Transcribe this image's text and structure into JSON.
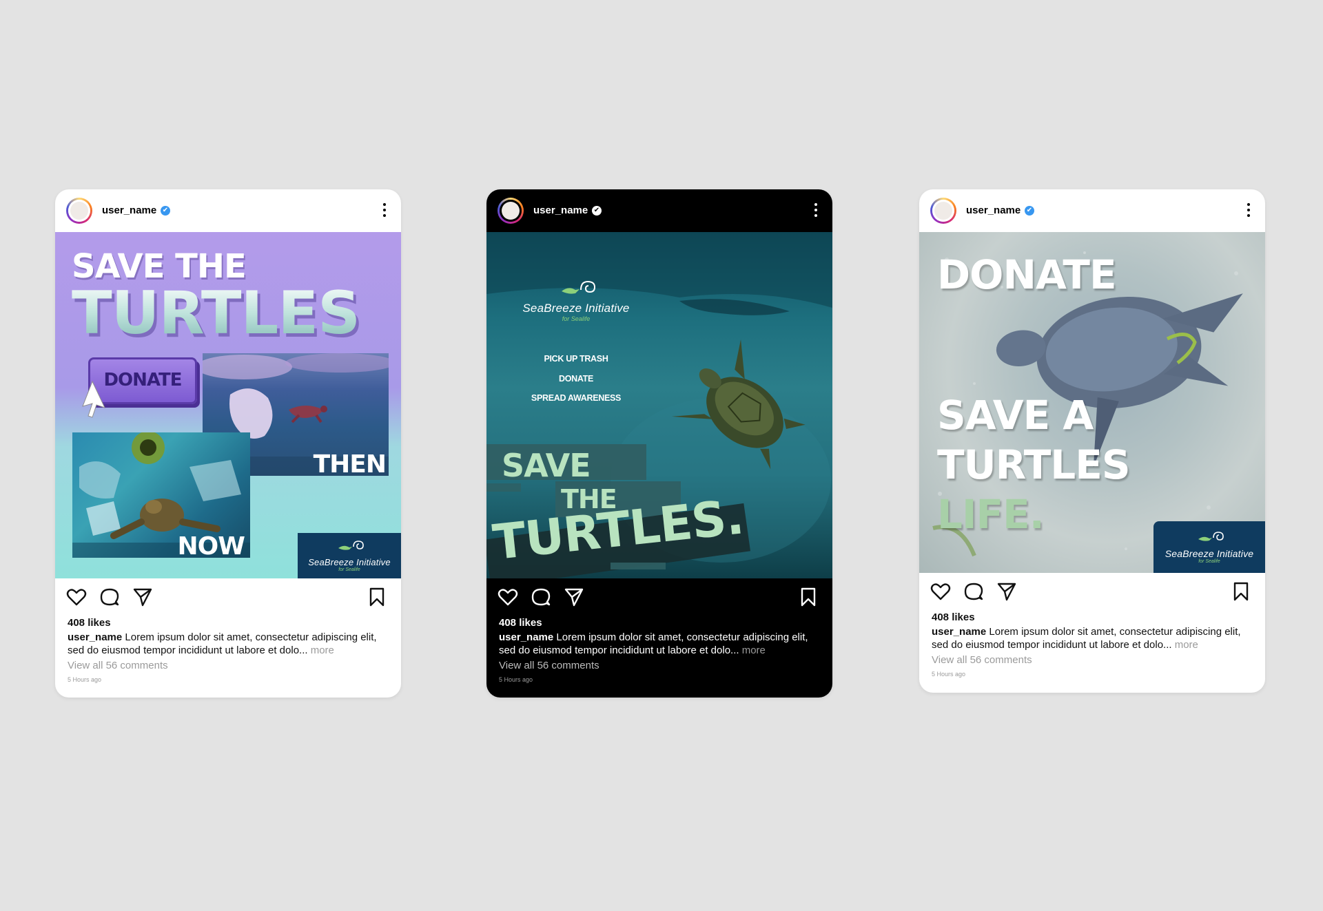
{
  "cards": [
    {
      "theme": "light",
      "header": {
        "username": "user_name",
        "verified_glyph": "✔"
      },
      "post": {
        "title_line1": "SAVE THE",
        "title_line2": "TURTLES",
        "donate_button": "DONATE",
        "label_then": "THEN",
        "label_now": "NOW",
        "logo_name": "SeaBreeze Initiative",
        "logo_sub": "for Sealife"
      },
      "footer": {
        "likes": "408 likes",
        "caption_user": "user_name",
        "caption_text": " Lorem ipsum dolor sit amet, consectetur adipiscing elit, sed do eiusmod tempor incididunt ut labore et dolo...",
        "caption_more": " more",
        "comments": "View all 56 comments",
        "time": "5 Hours ago"
      }
    },
    {
      "theme": "dark",
      "header": {
        "username": "user_name",
        "verified_glyph": "✔"
      },
      "post": {
        "logo_name": "SeaBreeze Initiative",
        "logo_sub": "for Sealife",
        "menu_items": [
          "PICK UP TRASH",
          "DONATE",
          "SPREAD AWARENESS"
        ],
        "word1": "SAVE",
        "word2": "THE",
        "word3": "TURTLES."
      },
      "footer": {
        "likes": "408 likes",
        "caption_user": "user_name",
        "caption_text": " Lorem ipsum dolor sit amet, consectetur adipiscing elit, sed do eiusmod tempor incididunt ut labore et dolo...",
        "caption_more": " more",
        "comments": "View all 56 comments",
        "time": "5 Hours ago"
      }
    },
    {
      "theme": "light",
      "header": {
        "username": "user_name",
        "verified_glyph": "✔"
      },
      "post": {
        "line1": "DONATE",
        "line2": "SAVE A",
        "line3": "TURTLES",
        "line4": "LIFE.",
        "logo_name": "SeaBreeze Initiative",
        "logo_sub": "for Sealife"
      },
      "footer": {
        "likes": "408 likes",
        "caption_user": "user_name",
        "caption_text": " Lorem ipsum dolor sit amet, consectetur adipiscing elit, sed do eiusmod tempor incididunt ut labore et dolo...",
        "caption_more": " more",
        "comments": "View all 56 comments",
        "time": "5 Hours ago"
      }
    }
  ],
  "colors": {
    "page_background": "#e3e3e3",
    "verified_blue": "#3897f0",
    "logo_navy": "#0f3b5f",
    "logo_green": "#8dd07a",
    "post1_purple": "#b39bea",
    "post1_mint": "#8fe1db",
    "post2_teal": "#1d6f7e",
    "post2_green_text": "#b8e3bf"
  },
  "icons": [
    "heart-icon",
    "comment-icon",
    "share-icon",
    "bookmark-icon",
    "more-options-icon",
    "verified-badge-icon"
  ]
}
